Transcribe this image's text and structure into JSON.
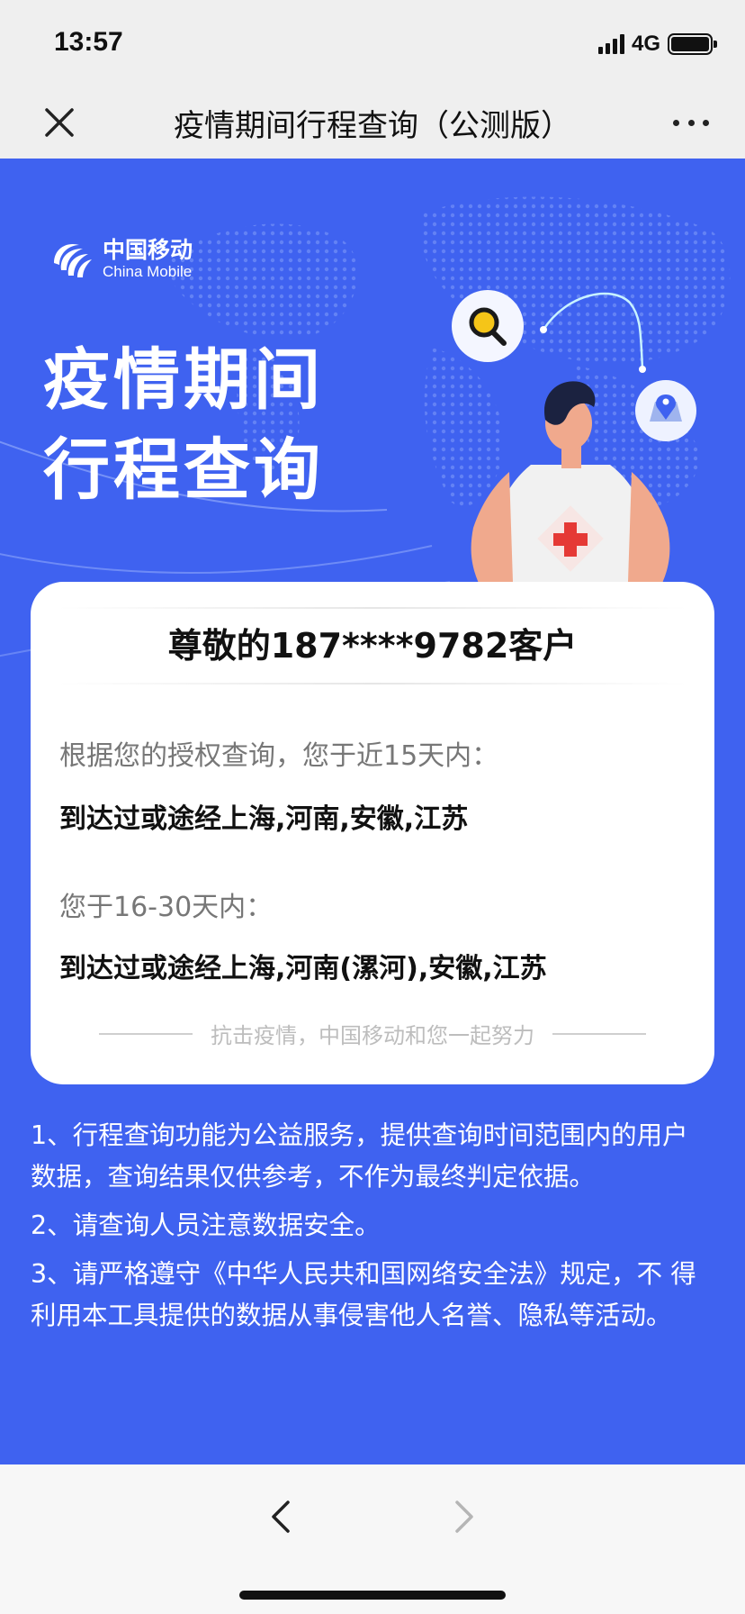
{
  "status_bar": {
    "time": "13:57",
    "network": "4G"
  },
  "navbar": {
    "title": "疫情期间行程查询（公测版）"
  },
  "logo": {
    "name_cn": "中国移动",
    "name_en": "China Mobile"
  },
  "hero": {
    "title_line1": "疫情期间",
    "title_line2": "行程查询"
  },
  "card": {
    "greeting": "尊敬的187****9782客户",
    "label_15": "根据您的授权查询，您于近15天内：",
    "value_15": "到达过或途经上海,河南,安徽,江苏",
    "label_30": "您于16-30天内：",
    "value_30": "到达过或途经上海,河南(漯河),安徽,江苏",
    "slogan": "抗击疫情，中国移动和您一起努力"
  },
  "notes": [
    "1、行程查询功能为公益服务，提供查询时间范围内的用户 数据，查询结果仅供参考，不作为最终判定依据。",
    "2、请查询人员注意数据安全。",
    "3、请严格遵守《中华人民共和国网络安全法》规定，不 得利用本工具提供的数据从事侵害他人名誉、隐私等活动。"
  ],
  "colors": {
    "primary": "#3f62f0",
    "accent_red": "#e53935",
    "card_bg": "#ffffff"
  },
  "icons": [
    "close-icon",
    "more-icon",
    "china-mobile-logo-icon",
    "search-icon",
    "location-pin-icon",
    "doctor-illustration",
    "back-icon",
    "forward-icon"
  ]
}
